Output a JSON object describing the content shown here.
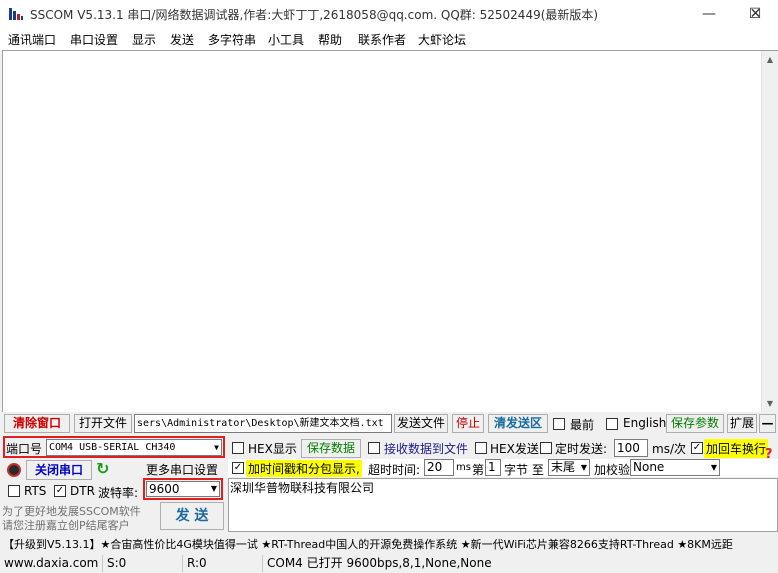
{
  "window": {
    "title": "SSCOM V5.13.1 串口/网络数据调试器,作者:大虾丁丁,2618058@qq.com. QQ群: 52502449(最新版本)",
    "minimize": "—",
    "maximize": "☐",
    "close": "✕"
  },
  "menu": [
    "通讯端口",
    "串口设置",
    "显示",
    "发送",
    "多字符串",
    "小工具",
    "帮助",
    "联系作者",
    "大虾论坛"
  ],
  "toolbar": {
    "clear_window": "清除窗口",
    "open_file": "打开文件",
    "file_path": "sers\\Administrator\\Desktop\\新建文本文档.txt",
    "send_file": "发送文件",
    "stop": "停止",
    "clear_send": "清发送区",
    "topmost": "最前",
    "english": "English",
    "save_params": "保存参数",
    "expand": "扩展",
    "collapse": "—"
  },
  "port": {
    "port_label": "端口号",
    "port_value": "COM4 USB-SERIAL CH340",
    "hex_display": "HEX显示",
    "save_data": "保存数据",
    "receive_to_file": "接收数据到文件",
    "hex_send": "HEX发送",
    "timed_send": "定时发送:",
    "interval_value": "100",
    "interval_unit": "ms/次",
    "append_crlf": "加回车换行",
    "help_mark": "?",
    "close_port": "关闭串口",
    "more_settings": "更多串口设置",
    "timestamp": "加时间戳和分包显示,",
    "timeout_label": "超时时间:",
    "timeout_value": "20",
    "timeout_unit": "ms",
    "nth_label": "第",
    "byte_value": "1",
    "byte_label": "字节 至",
    "to_end": "末尾",
    "checksum_label": "加校验",
    "checksum_value": "None",
    "rts": "RTS",
    "dtr": "DTR",
    "baud_label": "波特率:",
    "baud_value": "9600",
    "send_text": "深圳华普物联科技有限公司",
    "promo_line1": "为了更好地发展SSCOM软件",
    "promo_line2": "请您注册嘉立创P结尾客户",
    "send_button": "发 送"
  },
  "ticker": "【升级到V5.13.1】★合宙高性价比4G模块值得一试 ★RT-Thread中国人的开源免费操作系统 ★新一代WiFi芯片兼容8266支持RT-Thread ★8KM远距",
  "status": {
    "website": "www.daxia.com",
    "sent": "S:0",
    "received": "R:0",
    "port_status": "COM4 已打开  9600bps,8,1,None,None"
  },
  "checked_mark": "✓"
}
